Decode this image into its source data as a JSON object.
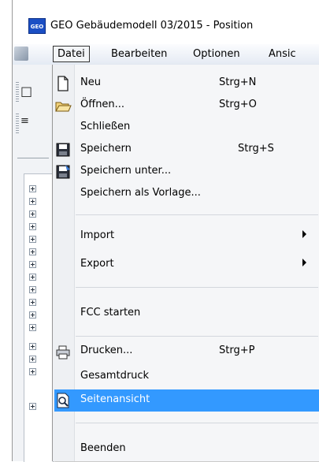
{
  "window": {
    "title": "GEO Gebäudemodell 03/2015 - Position",
    "app_icon_text": "GEO"
  },
  "menubar": {
    "items": [
      {
        "label": "Datei",
        "active": true
      },
      {
        "label": "Bearbeiten"
      },
      {
        "label": "Optionen"
      },
      {
        "label": "Ansic"
      }
    ]
  },
  "menu": {
    "items": [
      {
        "label": "Neu",
        "shortcut": "Strg+N",
        "icon": "new-document-icon"
      },
      {
        "label": "Öffnen...",
        "shortcut": "Strg+O",
        "icon": "open-folder-icon"
      },
      {
        "label": "Schließen",
        "shortcut": ""
      },
      {
        "label": "Speichern",
        "shortcut": "Strg+S",
        "icon": "save-icon"
      },
      {
        "label": "Speichern unter...",
        "shortcut": "",
        "icon": "save-as-icon"
      },
      {
        "label": "Speichern als Vorlage...",
        "shortcut": ""
      },
      {
        "label": "Import",
        "submenu": true
      },
      {
        "label": "Export",
        "submenu": true
      },
      {
        "label": "FCC starten"
      },
      {
        "label": "Drucken...",
        "shortcut": "Strg+P",
        "icon": "printer-icon"
      },
      {
        "label": "Gesamtdruck"
      },
      {
        "label": "Seitenansicht",
        "icon": "print-preview-icon",
        "selected": true
      },
      {
        "label": "Beenden"
      }
    ]
  },
  "colors": {
    "selection": "#3399ff",
    "menu_background": "#f5f6f8",
    "app_icon": "#1b4fc4"
  }
}
